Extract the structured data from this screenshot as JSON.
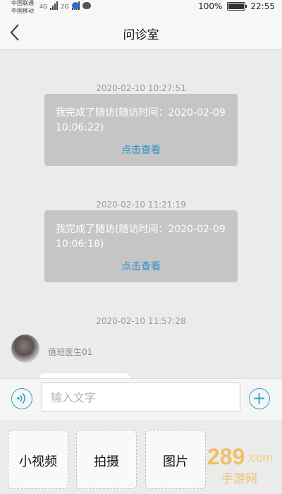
{
  "status_bar": {
    "carrier_1": "中国联通",
    "carrier_2": "中国移动",
    "network_1": "4G",
    "network_2": "2G",
    "battery_percent": "100%",
    "battery_level": 1.0,
    "time": "22:55"
  },
  "header": {
    "title": "问诊室",
    "back_icon": "chevron-left-icon"
  },
  "chat": {
    "messages": [
      {
        "timestamp": "2020-02-10 10:27:51",
        "text": "我完成了随访(随访时间：2020-02-09 10:06:22)",
        "action": "点击查看"
      },
      {
        "timestamp": "2020-02-10 11:21:19",
        "text": "我完成了随访(随访时间：2020-02-09 10:06:18)",
        "action": "点击查看"
      }
    ],
    "last_timestamp": "2020-02-10 11:57:28",
    "doctor_name": "值班医生01"
  },
  "input_bar": {
    "placeholder": "输入文字",
    "voice_icon": "voice-wave-icon",
    "add_icon": "plus-circle-icon"
  },
  "attachments": {
    "items": [
      {
        "label": "小视频"
      },
      {
        "label": "拍摄"
      },
      {
        "label": "图片"
      }
    ]
  },
  "watermark": {
    "brand": "289.com",
    "text": "手游网"
  },
  "colors": {
    "accent": "#2aa3c5",
    "link": "#2d8fd1",
    "card_bg": "#c5c5c5",
    "page_bg": "#ebebeb"
  }
}
